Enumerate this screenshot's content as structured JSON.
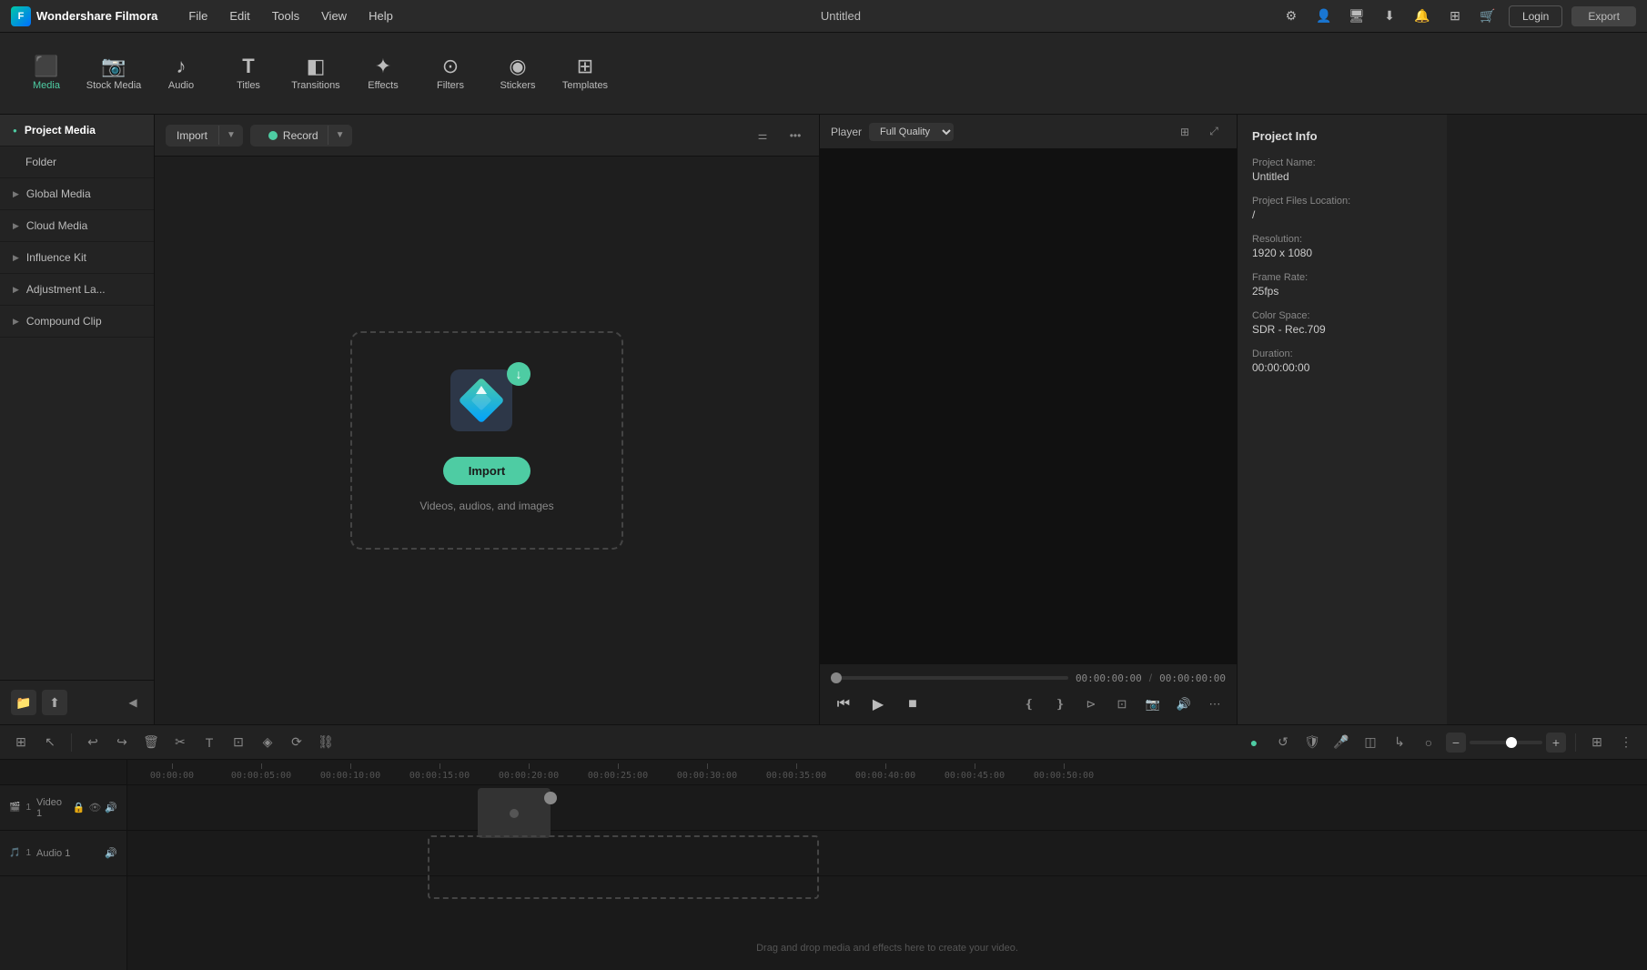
{
  "app": {
    "name": "Wondershare Filmora",
    "title": "Untitled",
    "logo_text": "F"
  },
  "menu": {
    "items": [
      "File",
      "Edit",
      "Tools",
      "View",
      "Help"
    ]
  },
  "topbar": {
    "login_label": "Login",
    "export_label": "Export"
  },
  "toolbar": {
    "items": [
      {
        "id": "media",
        "label": "Media",
        "icon": "🎬",
        "active": true
      },
      {
        "id": "stock-media",
        "label": "Stock Media",
        "icon": "📷"
      },
      {
        "id": "audio",
        "label": "Audio",
        "icon": "🎵"
      },
      {
        "id": "titles",
        "label": "Titles",
        "icon": "T"
      },
      {
        "id": "transitions",
        "label": "Transitions",
        "icon": "⬛"
      },
      {
        "id": "effects",
        "label": "Effects",
        "icon": "✦"
      },
      {
        "id": "filters",
        "label": "Filters",
        "icon": "🔘"
      },
      {
        "id": "stickers",
        "label": "Stickers",
        "icon": "😊"
      },
      {
        "id": "templates",
        "label": "Templates",
        "icon": "⊞"
      }
    ]
  },
  "sidebar": {
    "sections": [
      {
        "id": "project-media",
        "label": "Project Media",
        "active": true
      },
      {
        "id": "folder",
        "label": "Folder",
        "indent": true
      },
      {
        "id": "global-media",
        "label": "Global Media"
      },
      {
        "id": "cloud-media",
        "label": "Cloud Media"
      },
      {
        "id": "influence-kit",
        "label": "Influence Kit"
      },
      {
        "id": "adjustment-layer",
        "label": "Adjustment La..."
      },
      {
        "id": "compound-clip",
        "label": "Compound Clip"
      }
    ]
  },
  "media_panel": {
    "import_label": "Import",
    "record_label": "Record",
    "drop_zone_text": "Videos, audios, and images",
    "import_btn_label": "Import"
  },
  "player": {
    "label": "Player",
    "quality": "Full Quality",
    "current_time": "00:00:00:00",
    "total_time": "00:00:00:00"
  },
  "project_info": {
    "title": "Project Info",
    "fields": [
      {
        "label": "Project Name:",
        "value": "Untitled"
      },
      {
        "label": "Project Files Location:",
        "value": "/"
      },
      {
        "label": "Resolution:",
        "value": "1920 x 1080"
      },
      {
        "label": "Frame Rate:",
        "value": "25fps"
      },
      {
        "label": "Color Space:",
        "value": "SDR - Rec.709"
      },
      {
        "label": "Duration:",
        "value": "00:00:00:00"
      }
    ]
  },
  "timeline": {
    "ruler_marks": [
      "00:00:00",
      "00:00:05:00",
      "00:00:10:00",
      "00:00:15:00",
      "00:00:20:00",
      "00:00:25:00",
      "00:00:30:00",
      "00:00:35:00",
      "00:00:40:00",
      "00:00:45:00",
      "00:00:50:00"
    ],
    "tracks": [
      {
        "id": "video-1",
        "label": "Video 1",
        "icon": "🎬"
      },
      {
        "id": "audio-1",
        "label": "Audio 1",
        "icon": "🎵"
      }
    ],
    "drop_text": "Drag and drop media and effects here to create your video."
  }
}
